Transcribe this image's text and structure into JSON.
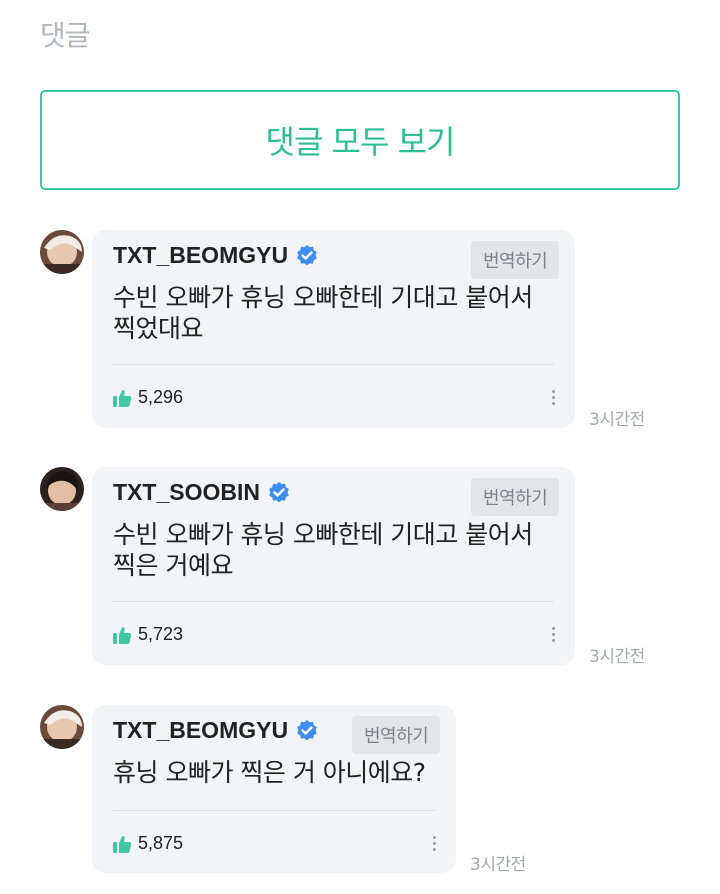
{
  "section_title": "댓글",
  "view_all_label": "댓글 모두 보기",
  "comments": [
    {
      "username": "TXT_BEOMGYU",
      "translate_label": "번역하기",
      "text": "수빈 오빠가 휴닝 오빠한테 기대고 붙어서\n찍었대요",
      "likes": "5,296",
      "time": "3시간전"
    },
    {
      "username": "TXT_SOOBIN",
      "translate_label": "번역하기",
      "text": "수빈 오빠가 휴닝 오빠한테 기대고 붙어서\n찍은 거예요",
      "likes": "5,723",
      "time": "3시간전"
    },
    {
      "username": "TXT_BEOMGYU",
      "translate_label": "번역하기",
      "text": "휴닝 오빠가 찍은 거 아니에요?",
      "likes": "5,875",
      "time": "3시간전"
    }
  ],
  "colors": {
    "accent": "#2fbf95",
    "verified": "#3d8ef0",
    "bubble": "#f3f4f7"
  },
  "icons": [
    "verified-badge-icon",
    "thumbs-up-icon",
    "more-vertical-icon",
    "user-avatar"
  ]
}
